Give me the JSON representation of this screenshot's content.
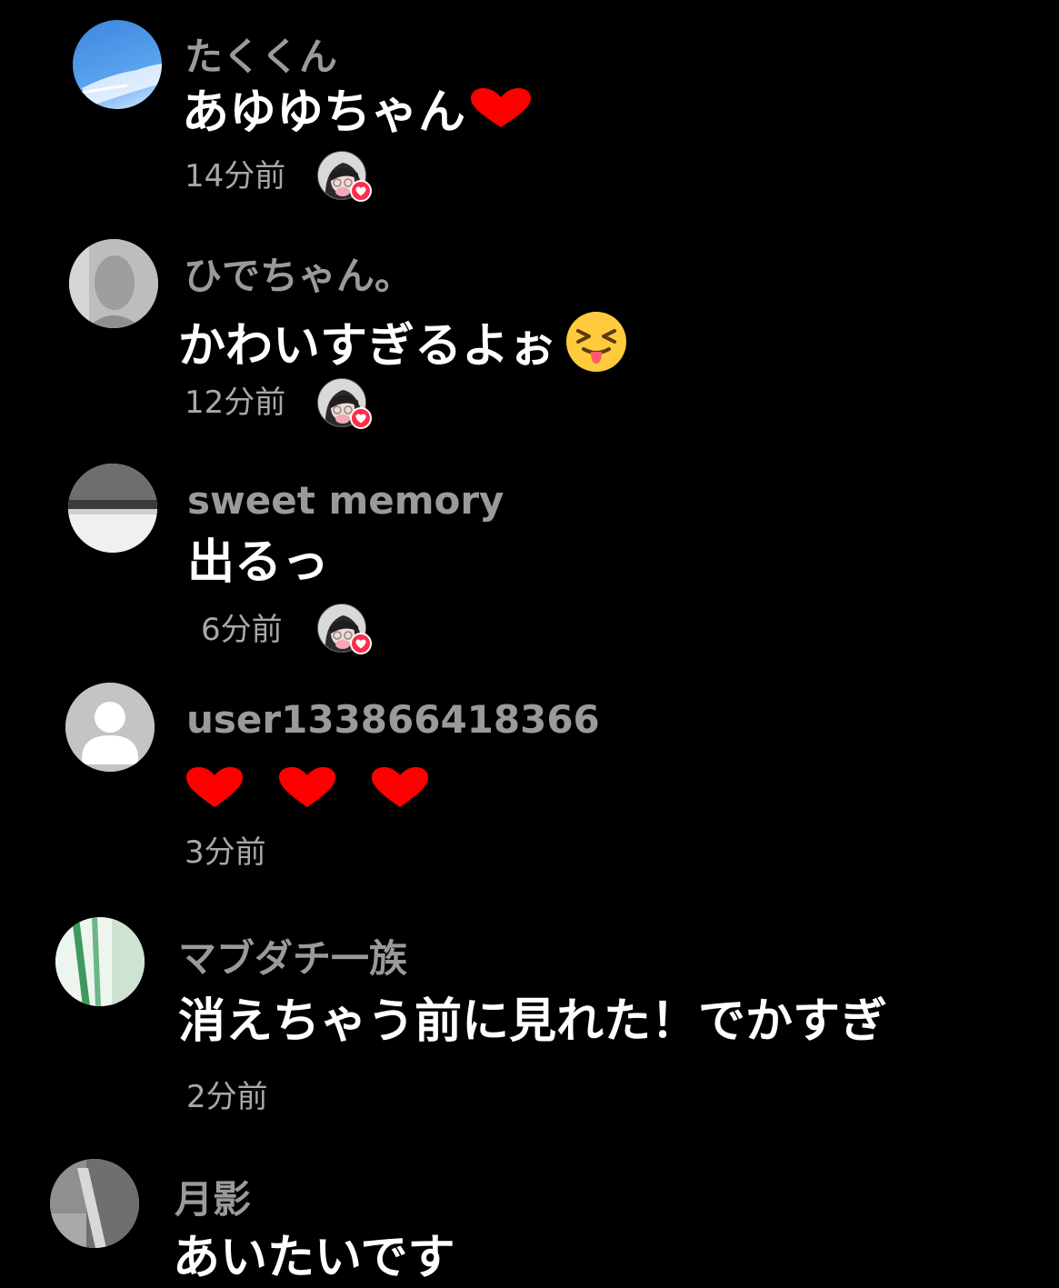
{
  "comments": [
    {
      "username": "たくくん",
      "text": "あゆゆちゃん",
      "trailing_icon": "red-heart-icon",
      "time": "14分前",
      "liked_by_creator": true
    },
    {
      "username": "ひでちゃん。",
      "text": "かわいすぎるよぉ",
      "trailing_icon": "squinting-tongue-emoji-icon",
      "time": "12分前",
      "liked_by_creator": true
    },
    {
      "username": "sweet memory",
      "text": "出るっ",
      "time": "6分前",
      "liked_by_creator": true
    },
    {
      "username": "user133866418366",
      "text": "",
      "icons": [
        "red-heart-icon",
        "red-heart-icon",
        "red-heart-icon"
      ],
      "time": "3分前",
      "liked_by_creator": false
    },
    {
      "username": "マブダチ一族",
      "text": "消えちゃう前に見れた！でかすぎ",
      "time": "2分前",
      "liked_by_creator": false
    },
    {
      "username": "月影",
      "text": "あいたいです",
      "liked_by_creator": false
    }
  ],
  "colors": {
    "background": "#000000",
    "username": "#9a9a9a",
    "comment_text": "#ffffff",
    "timestamp": "#a8a8a8",
    "heart": "#ff0000",
    "like_badge": "#ff2d4a"
  }
}
